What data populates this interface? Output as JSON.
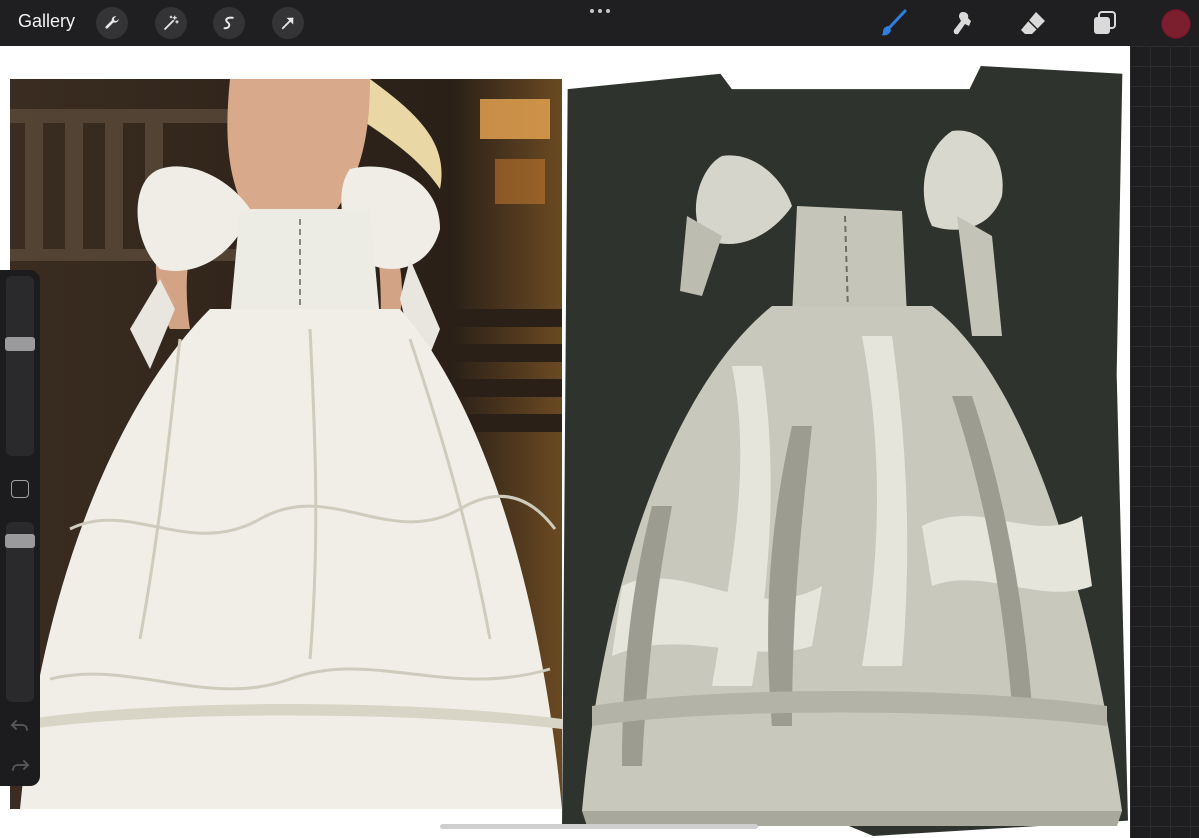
{
  "toolbar": {
    "gallery_label": "Gallery",
    "left_tools": [
      "wrench-icon",
      "magic-wand-icon",
      "selection-s-icon",
      "transform-arrow-icon"
    ],
    "right_tools": [
      "brush-icon",
      "smudge-icon",
      "eraser-icon",
      "layers-icon"
    ],
    "active_tool": "brush",
    "active_tool_color": "#2f7fe0",
    "current_color": "#7b1e2e"
  },
  "canvas": {
    "left_image": "reference-photo-white-ruffled-gown",
    "right_image": "painting-study-white-ruffled-gown",
    "painting_background": "#2f332d"
  },
  "sidebar": {
    "brush_size": 0.63,
    "brush_opacity": 0.93
  }
}
